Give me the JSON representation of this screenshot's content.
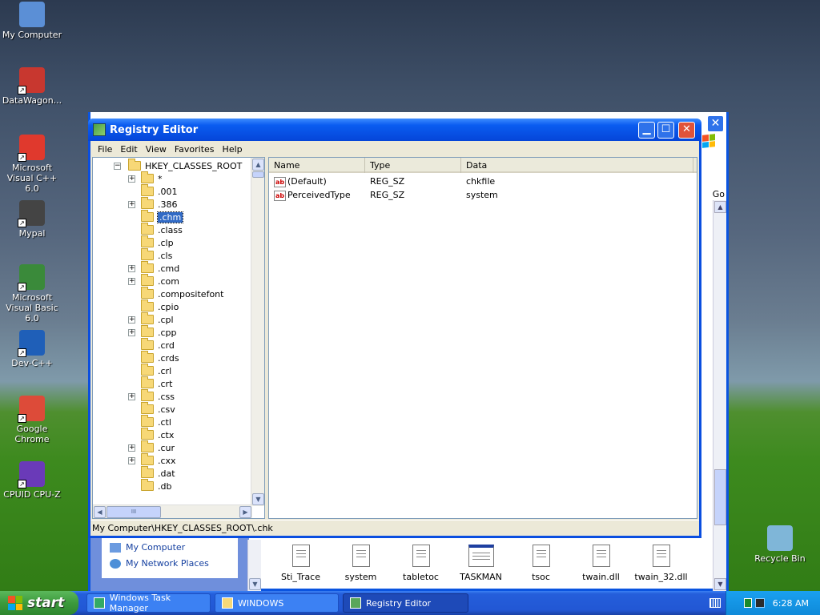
{
  "desktop": {
    "icons": [
      {
        "label": "My Computer",
        "color": "#5b8fd6"
      },
      {
        "label": "DataWagon...",
        "color": "#c8372f"
      },
      {
        "label": "Microsoft Visual C++ 6.0",
        "color": "#e0392d"
      },
      {
        "label": "Mypal",
        "color": "#444444"
      },
      {
        "label": "Microsoft Visual Basic 6.0",
        "color": "#3a8a3a"
      },
      {
        "label": "Dev-C++",
        "color": "#1f5fb8"
      },
      {
        "label": "Google Chrome",
        "color": "#dd4b39"
      },
      {
        "label": "CPUID CPU-Z",
        "color": "#6a3ab8"
      },
      {
        "label": "Recycle Bin",
        "color": "#7fb6d8"
      }
    ]
  },
  "background_window": {
    "left_links": [
      "My Computer",
      "My Network Places"
    ],
    "files": [
      "Sti_Trace",
      "system",
      "tabletoc",
      "TASKMAN",
      "tsoc",
      "twain.dll",
      "twain_32.dll"
    ],
    "go_label": "Go"
  },
  "registry": {
    "title": "Registry Editor",
    "menu": [
      "File",
      "Edit",
      "View",
      "Favorites",
      "Help"
    ],
    "tree": [
      {
        "label": "HKEY_CLASSES_ROOT",
        "expander": "−",
        "level": 0
      },
      {
        "label": "*",
        "expander": "+",
        "level": 1
      },
      {
        "label": ".001",
        "expander": "",
        "level": 1
      },
      {
        "label": ".386",
        "expander": "+",
        "level": 1
      },
      {
        "label": ".chm",
        "expander": "",
        "level": 1,
        "selected": true
      },
      {
        "label": ".class",
        "expander": "",
        "level": 1
      },
      {
        "label": ".clp",
        "expander": "",
        "level": 1
      },
      {
        "label": ".cls",
        "expander": "",
        "level": 1
      },
      {
        "label": ".cmd",
        "expander": "+",
        "level": 1
      },
      {
        "label": ".com",
        "expander": "+",
        "level": 1
      },
      {
        "label": ".compositefont",
        "expander": "",
        "level": 1
      },
      {
        "label": ".cpio",
        "expander": "",
        "level": 1
      },
      {
        "label": ".cpl",
        "expander": "+",
        "level": 1
      },
      {
        "label": ".cpp",
        "expander": "+",
        "level": 1
      },
      {
        "label": ".crd",
        "expander": "",
        "level": 1
      },
      {
        "label": ".crds",
        "expander": "",
        "level": 1
      },
      {
        "label": ".crl",
        "expander": "",
        "level": 1
      },
      {
        "label": ".crt",
        "expander": "",
        "level": 1
      },
      {
        "label": ".css",
        "expander": "+",
        "level": 1
      },
      {
        "label": ".csv",
        "expander": "",
        "level": 1
      },
      {
        "label": ".ctl",
        "expander": "",
        "level": 1
      },
      {
        "label": ".ctx",
        "expander": "",
        "level": 1
      },
      {
        "label": ".cur",
        "expander": "+",
        "level": 1
      },
      {
        "label": ".cxx",
        "expander": "+",
        "level": 1
      },
      {
        "label": ".dat",
        "expander": "",
        "level": 1
      },
      {
        "label": ".db",
        "expander": "",
        "level": 1
      }
    ],
    "columns": [
      "Name",
      "Type",
      "Data"
    ],
    "values": [
      {
        "name": "(Default)",
        "type": "REG_SZ",
        "data": "chkfile"
      },
      {
        "name": "PerceivedType",
        "type": "REG_SZ",
        "data": "system"
      }
    ],
    "status": "My Computer\\HKEY_CLASSES_ROOT\\.chk",
    "scroll_arrows": {
      "up": "▲",
      "down": "▼",
      "left": "◀",
      "right": "▶",
      "grip": "III"
    }
  },
  "taskbar": {
    "start_label": "start",
    "tasks": [
      "Windows Task Manager",
      "WINDOWS",
      "Registry Editor"
    ],
    "active_task": "Registry Editor",
    "clock": "6:28 AM"
  }
}
